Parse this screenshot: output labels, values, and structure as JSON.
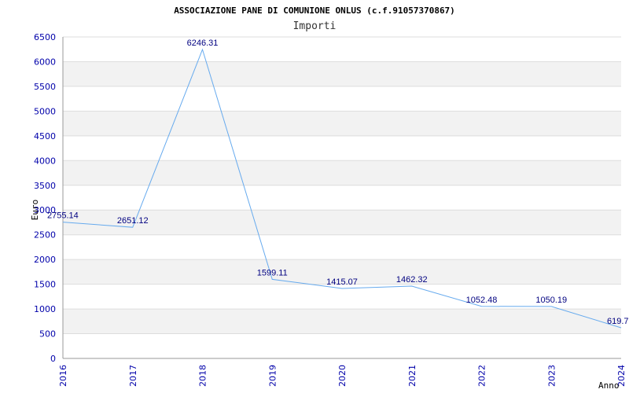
{
  "chart_data": {
    "type": "line",
    "title": "ASSOCIAZIONE PANE DI COMUNIONE ONLUS (c.f.91057370867)",
    "subtitle": "Importi",
    "xlabel": "Anno",
    "ylabel": "Euro",
    "x": [
      "2016",
      "2017",
      "2018",
      "2019",
      "2020",
      "2021",
      "2022",
      "2023",
      "2024"
    ],
    "values": [
      2755.14,
      2651.12,
      6246.31,
      1599.11,
      1415.07,
      1462.32,
      1052.48,
      1050.19,
      619.7
    ],
    "data_labels": [
      "2755.14",
      "2651.12",
      "6246.31",
      "1599.11",
      "1415.07",
      "1462.32",
      "1052.48",
      "1050.19",
      "619.7"
    ],
    "ylim": [
      0,
      6500
    ],
    "yticks": [
      "0",
      "500",
      "1000",
      "1500",
      "2000",
      "2500",
      "3000",
      "3500",
      "4000",
      "4500",
      "5000",
      "5500",
      "6000",
      "6500"
    ],
    "grid": true,
    "colors": {
      "line": "#66aaee",
      "band": "#f2f2f2",
      "grid": "#dddddd",
      "tick_text": "#0000aa",
      "label_text": "#000080"
    }
  }
}
